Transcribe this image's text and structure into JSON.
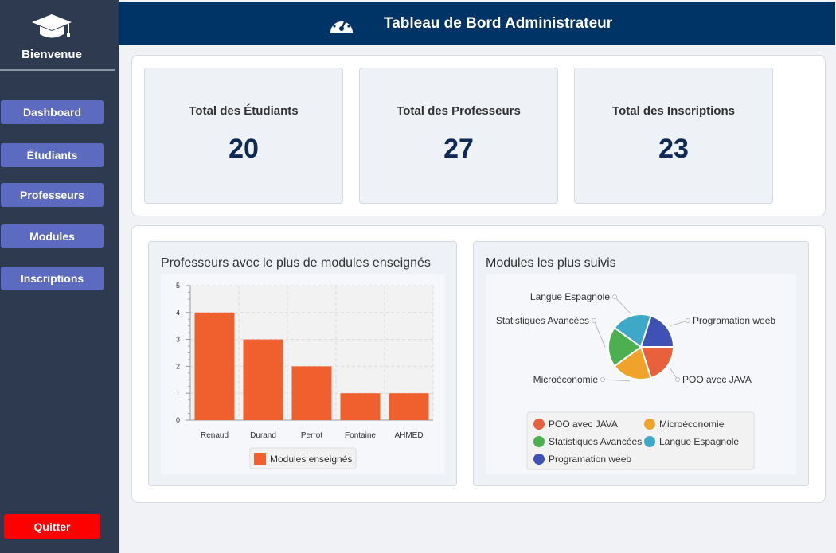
{
  "sidebar": {
    "welcome": "Bienvenue",
    "items": [
      {
        "label": "Dashboard"
      },
      {
        "label": "Étudiants"
      },
      {
        "label": "Professeurs"
      },
      {
        "label": "Modules"
      },
      {
        "label": "Inscriptions"
      }
    ],
    "quit": "Quitter"
  },
  "header": {
    "title": "Tableau de Bord Administrateur",
    "icon": "gauge-icon"
  },
  "stats": [
    {
      "label": "Total des Étudiants",
      "value": "20"
    },
    {
      "label": "Total des Professeurs",
      "value": "27"
    },
    {
      "label": "Total des Inscriptions",
      "value": "23"
    }
  ],
  "colors": {
    "sidebar": "#2d3a4f",
    "header": "#003366",
    "nav_button": "#5c6bc0",
    "quit_button": "#ff0000",
    "bar": "#f0602e"
  },
  "chart_data": [
    {
      "type": "bar",
      "title": "Professeurs avec le plus de modules enseignés",
      "categories": [
        "Renaud",
        "Durand",
        "Perrot",
        "Fontaine",
        "AHMED"
      ],
      "series": [
        {
          "name": "Modules enseignés",
          "values": [
            4,
            3,
            2,
            1,
            1
          ]
        }
      ],
      "ylim": [
        0,
        5
      ],
      "yticks": [
        "0",
        "1",
        "2",
        "3",
        "4",
        "5"
      ],
      "grid": true,
      "legend": "bottom"
    },
    {
      "type": "pie",
      "title": "Modules les plus suivis",
      "labels": [
        "POO avec JAVA",
        "Microéconomie",
        "Statistiques Avancées",
        "Langue Espagnole",
        "Programation weeb"
      ],
      "values": [
        1,
        1,
        1,
        1,
        1
      ],
      "colors": [
        "#e8603c",
        "#f0a32a",
        "#4caf50",
        "#3da8c7",
        "#3f51b5"
      ],
      "legend": "bottom"
    }
  ]
}
